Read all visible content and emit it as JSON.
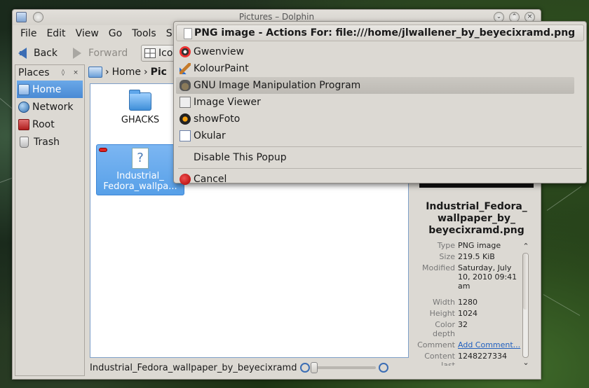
{
  "window": {
    "title": "Pictures – Dolphin",
    "menu": [
      "File",
      "Edit",
      "View",
      "Go",
      "Tools",
      "S"
    ],
    "toolbar": {
      "back": "Back",
      "forward": "Forward",
      "view_mode": "Ico"
    }
  },
  "places": {
    "header": "Places",
    "items": [
      {
        "label": "Home",
        "icon": "home-icon",
        "selected": true
      },
      {
        "label": "Network",
        "icon": "network-icon"
      },
      {
        "label": "Root",
        "icon": "root-icon"
      },
      {
        "label": "Trash",
        "icon": "trash-icon"
      }
    ]
  },
  "breadcrumb": {
    "home": "Home",
    "current": "Pic"
  },
  "files": [
    {
      "name": "GHACKS",
      "type": "folder"
    },
    {
      "name": "Industrial_ Fedora_wallpa...",
      "type": "image",
      "selected": true
    }
  ],
  "status": {
    "text": "Industrial_Fedora_wallpaper_by_beyecixramd"
  },
  "info": {
    "name": "Industrial_Fedora_ wallpaper_by_ beyecixramd.png",
    "meta": [
      {
        "key": "Type",
        "value": "PNG image"
      },
      {
        "key": "Size",
        "value": "219.5 KiB"
      },
      {
        "key": "Modified",
        "value": "Saturday, July 10, 2010 09:41 am"
      },
      {
        "key": "Width",
        "value": "1280"
      },
      {
        "key": "Height",
        "value": "1024"
      },
      {
        "key": "Color depth",
        "value": "32"
      },
      {
        "key": "Comment",
        "value": "Add Comment..."
      },
      {
        "key": "Content last modified",
        "value": "1248227334"
      }
    ]
  },
  "popup": {
    "title": "PNG image - Actions For: file:///home/jlwallener_by_beyecixramd.png",
    "items": [
      {
        "label": "Gwenview",
        "icon": "gwenview-icon"
      },
      {
        "label": "KolourPaint",
        "icon": "kolourpaint-icon"
      },
      {
        "label": "GNU Image Manipulation Program",
        "icon": "gimp-icon",
        "highlighted": true
      },
      {
        "label": "Image Viewer",
        "icon": "image-viewer-icon"
      },
      {
        "label": "showFoto",
        "icon": "showfoto-icon"
      },
      {
        "label": "Okular",
        "icon": "okular-icon"
      }
    ],
    "disable": "Disable This Popup",
    "cancel": "Cancel"
  }
}
